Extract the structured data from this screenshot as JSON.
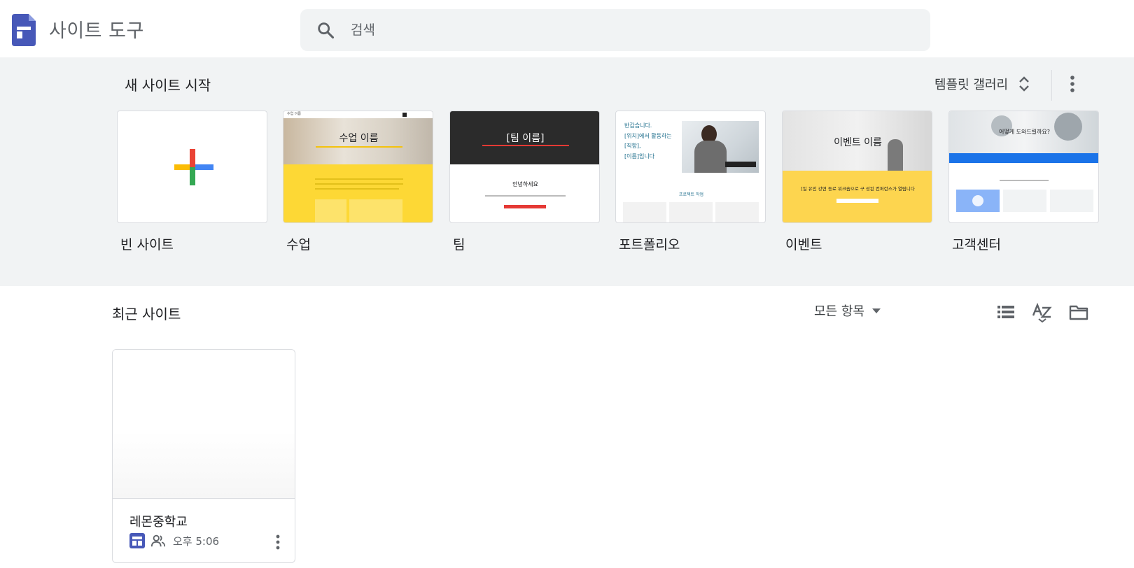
{
  "header": {
    "app_title": "사이트 도구",
    "search_placeholder": "검색",
    "brand_color": "#4758b8"
  },
  "templates": {
    "section_title": "새 사이트 시작",
    "gallery_label": "템플릿 갤러리",
    "items": [
      {
        "label": "빈 사이트"
      },
      {
        "label": "수업",
        "thumb_title": "수업 이름",
        "thumb_topbar": "수업 이름"
      },
      {
        "label": "팀",
        "thumb_title": "[팀 이름]",
        "thumb_subtitle": "안녕하세요"
      },
      {
        "label": "포트폴리오",
        "thumb_lines": [
          "반갑습니다.",
          "[위치]에서 활동하는",
          "[직함],",
          "[이름]입니다"
        ],
        "thumb_caption": "프로젝트 작업"
      },
      {
        "label": "이벤트",
        "thumb_title": "이벤트 이름",
        "thumb_banner": "[일 유인 강연 동료 워크숍으로 구 성된 컨퍼런스가 열립니다"
      },
      {
        "label": "고객센터",
        "thumb_title": "어떻게 도와드릴까요?"
      }
    ]
  },
  "recent": {
    "section_title": "최근 사이트",
    "filter_label": "모든 항목",
    "sites": [
      {
        "name": "레몬중학교",
        "time": "오후 5:06"
      }
    ]
  }
}
